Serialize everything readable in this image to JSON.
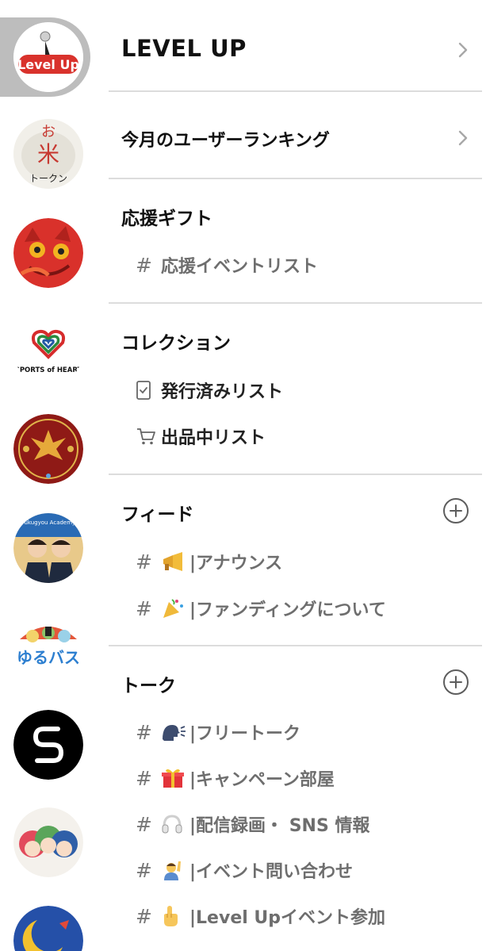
{
  "rail": {
    "servers": [
      {
        "name": "level-up",
        "label": "Level Up",
        "active": true
      },
      {
        "name": "okome-token",
        "label_top": "お",
        "label_mid": "米",
        "label_bottom": "トークン"
      },
      {
        "name": "red-cat"
      },
      {
        "name": "sports-of-heart",
        "label": "SPORTS of HEART"
      },
      {
        "name": "phoenix"
      },
      {
        "name": "fukugyou-academy",
        "label": "Fukugyou Academy"
      },
      {
        "name": "yurutai"
      },
      {
        "name": "s-logo"
      },
      {
        "name": "anime-girls"
      },
      {
        "name": "rocket"
      }
    ]
  },
  "header": {
    "title": "LEVEL UP"
  },
  "ranking": {
    "label": "今月のユーザーランキング"
  },
  "gift": {
    "title": "応援ギフト",
    "channels": [
      {
        "label": "応援イベントリスト"
      }
    ]
  },
  "collection": {
    "title": "コレクション",
    "items": [
      {
        "label": "発行済みリスト",
        "icon": "document-check-icon"
      },
      {
        "label": "出品中リスト",
        "icon": "cart-icon"
      }
    ]
  },
  "feed": {
    "title": "フィード",
    "channels": [
      {
        "emoji": "📣",
        "label": "|アナウンス"
      },
      {
        "emoji": "🎉",
        "label": "|ファンディングについて"
      }
    ]
  },
  "talk": {
    "title": "トーク",
    "channels": [
      {
        "emoji": "🗣",
        "label": "|フリートーク"
      },
      {
        "emoji": "🎁",
        "label": "|キャンペーン部屋"
      },
      {
        "emoji": "🎧",
        "label": "|配信録画・ SNS 情報"
      },
      {
        "emoji": "🙋",
        "label": "|イベント問い合わせ"
      },
      {
        "emoji": "☝",
        "label": "|Level Upイベント参加"
      }
    ]
  },
  "colors": {
    "text": "#111111",
    "channel_text": "#6e6e6e",
    "divider": "#dcdcdc",
    "active_indicator": "#bdbdbd",
    "levelup_red": "#d9322c"
  }
}
